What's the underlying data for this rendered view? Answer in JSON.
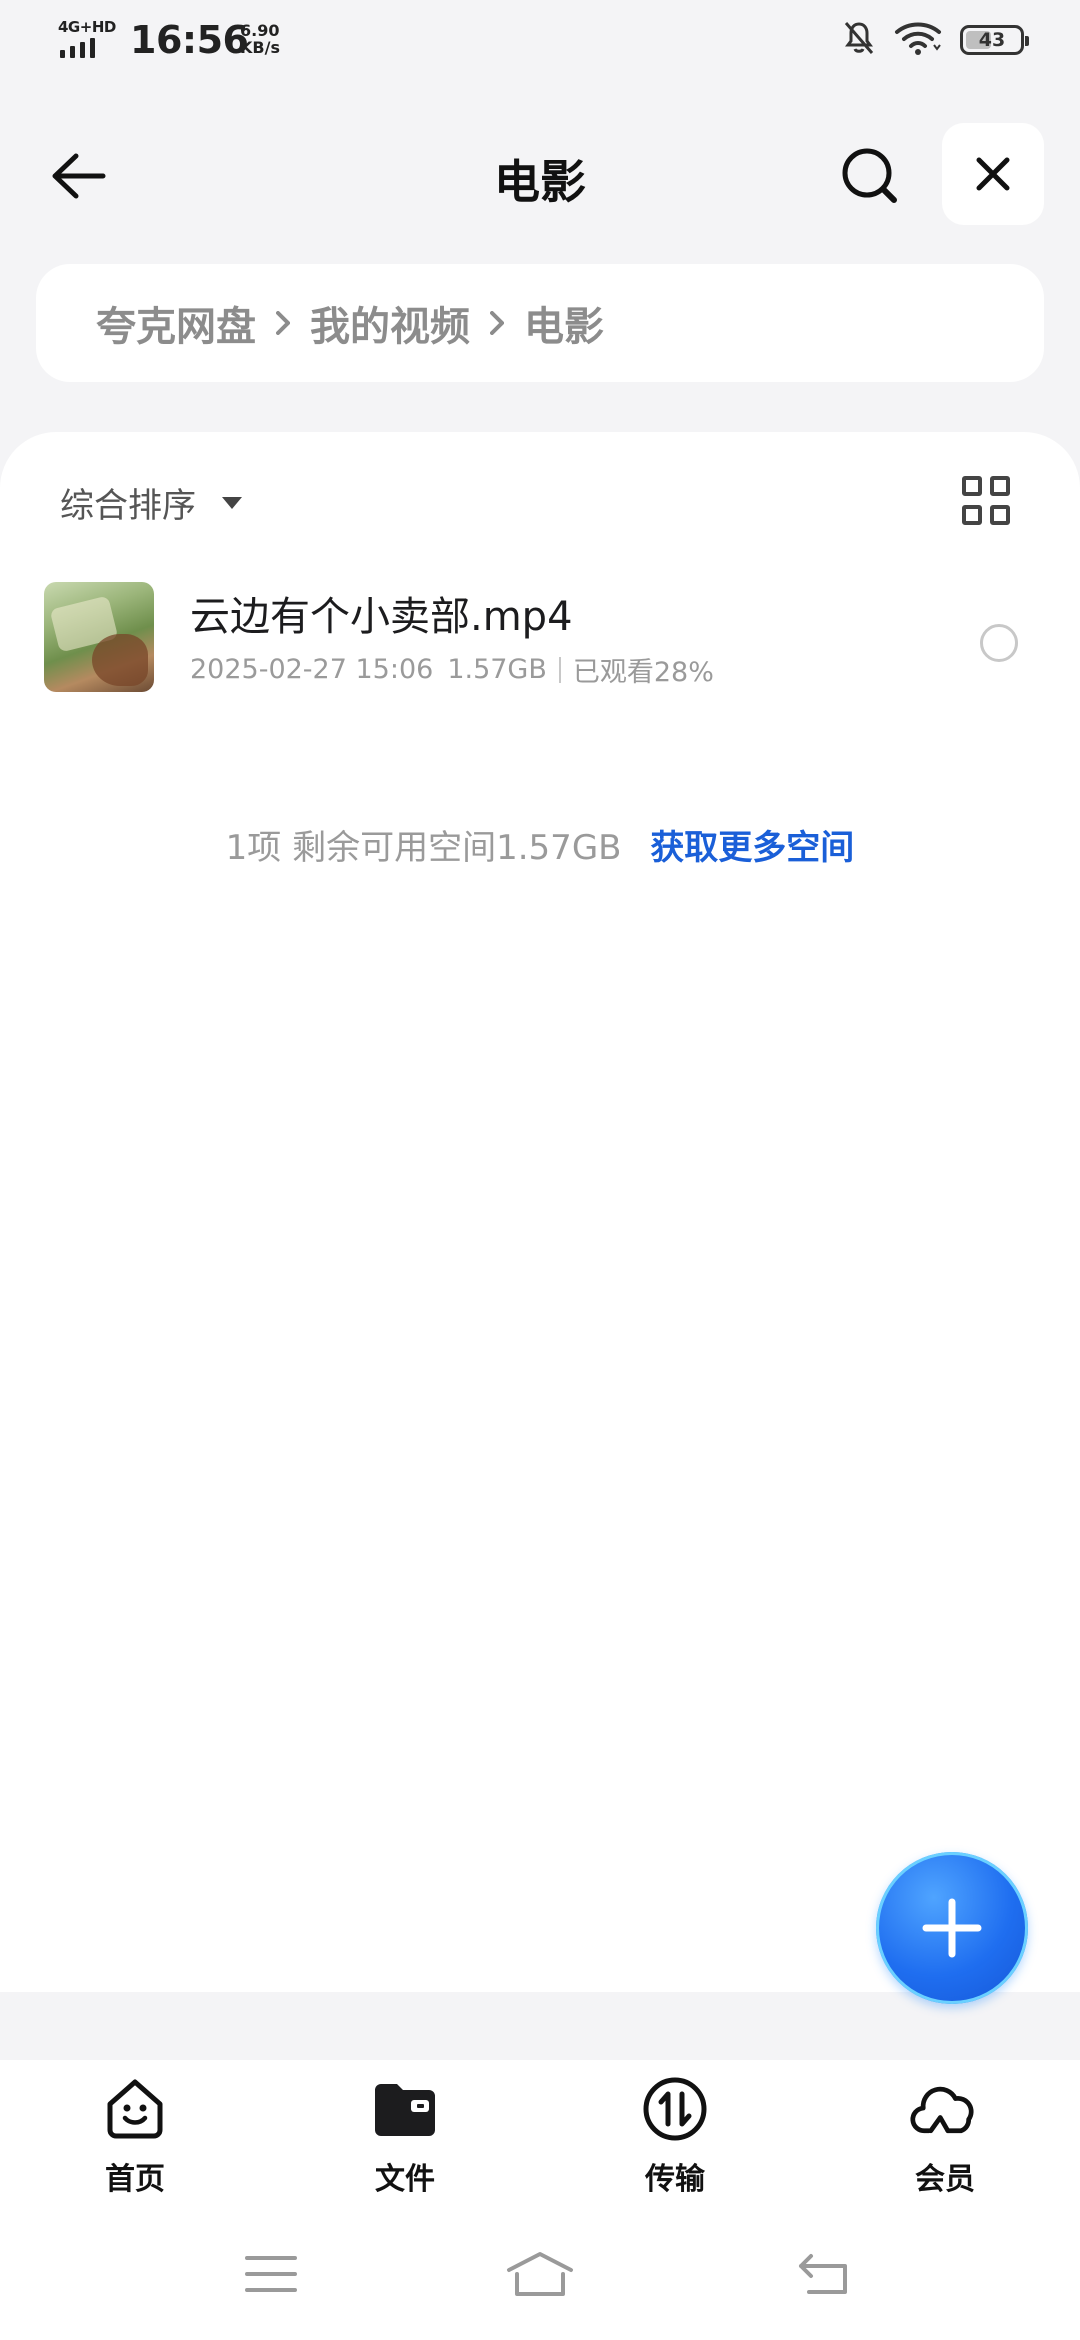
{
  "status_bar": {
    "network": "4G+HD",
    "time": "16:56",
    "speed_value": "6.90",
    "speed_unit": "KB/s",
    "battery": "43",
    "icons": [
      "signal-icon",
      "mute-icon",
      "wifi-icon",
      "battery-icon"
    ]
  },
  "header": {
    "title": "电影",
    "icons": [
      "back-arrow-icon",
      "search-icon",
      "close-icon"
    ]
  },
  "breadcrumb": [
    "夸克网盘",
    "我的视频",
    "电影"
  ],
  "toolbar": {
    "sort_label": "综合排序",
    "icons": [
      "caret-down-icon",
      "grid-view-icon"
    ]
  },
  "files": [
    {
      "name": "云边有个小卖部.mp4",
      "date": "2025-02-27 15:06",
      "size": "1.57GB",
      "progress": "已观看28%",
      "thumb_icon": "video-thumbnail"
    }
  ],
  "storage": {
    "summary": "1项 剩余可用空间1.57GB",
    "link": "获取更多空间"
  },
  "fab_icon": "plus-icon",
  "bottom_nav": [
    {
      "label": "首页",
      "icon": "home-face-icon"
    },
    {
      "label": "文件",
      "icon": "folder-icon"
    },
    {
      "label": "传输",
      "icon": "transfer-icon"
    },
    {
      "label": "会员",
      "icon": "cloud-icon"
    }
  ],
  "system_nav": [
    "menu-icon",
    "home-icon",
    "back-icon"
  ],
  "colors": {
    "accent": "#1a5fd8",
    "fab": "#1f6ef0",
    "background": "#f4f4f6",
    "muted_text": "#9a9a9a"
  }
}
